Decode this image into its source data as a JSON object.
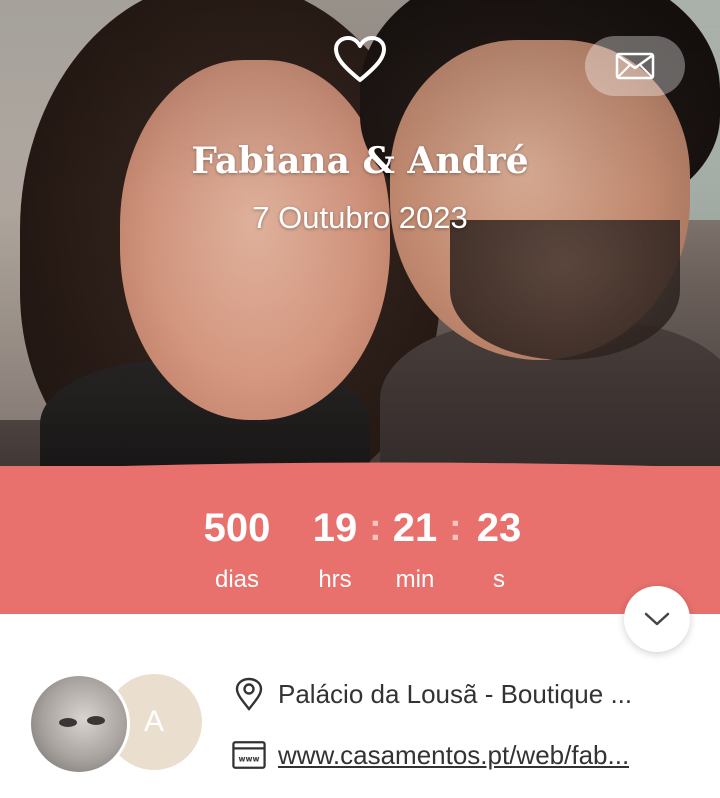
{
  "header": {
    "heart_icon": "heart-outline-icon",
    "mail_icon": "envelope-icon",
    "couple_names": "Fabiana & André",
    "date": "7 Outubro 2023"
  },
  "countdown": {
    "days": "500",
    "days_label": "dias",
    "hours": "19",
    "hours_label": "hrs",
    "minutes": "21",
    "minutes_label": "min",
    "seconds": "23",
    "seconds_label": "s",
    "separator": ":"
  },
  "scroll_icon": "chevron-down-icon",
  "info": {
    "avatar_initial": "A",
    "venue": "Palácio da Lousã - Boutique ...",
    "website": "www.casamentos.pt/web/fab..."
  },
  "colors": {
    "accent": "#e8706d",
    "avatar_initial_bg": "#eadfce",
    "text": "#333333"
  }
}
